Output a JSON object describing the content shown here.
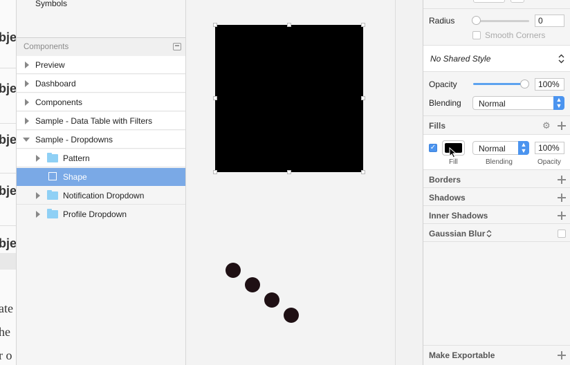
{
  "bg_doc": {
    "fragments_bold": [
      "bje",
      "bje",
      "bje",
      "bje",
      "bje"
    ],
    "fragments_serif": [
      "ate",
      "he",
      "r o"
    ]
  },
  "layers": {
    "symbols_label": "Symbols",
    "components_header": "Components",
    "rows": [
      {
        "label": "Preview"
      },
      {
        "label": "Dashboard"
      },
      {
        "label": "Components"
      },
      {
        "label": "Sample - Data Table with Filters"
      },
      {
        "label": "Sample - Dropdowns"
      },
      {
        "label": "Pattern"
      },
      {
        "label": "Shape"
      },
      {
        "label": "Notification Dropdown"
      },
      {
        "label": "Profile Dropdown"
      }
    ]
  },
  "inspector": {
    "radius_label": "Radius",
    "radius_value": "0",
    "smooth_corners_label": "Smooth Corners",
    "shared_style": "No Shared Style",
    "opacity_label": "Opacity",
    "opacity_value": "100%",
    "blending_label": "Blending",
    "blending_value": "Normal",
    "fills_title": "Fills",
    "fill_blending_value": "Normal",
    "fill_opacity_value": "100%",
    "fill_caption": "Fill",
    "fill_blending_caption": "Blending",
    "fill_opacity_caption": "Opacity",
    "fill_color": "#000000",
    "borders_title": "Borders",
    "shadows_title": "Shadows",
    "inner_shadows_title": "Inner Shadows",
    "gaussian_blur_title": "Gaussian Blur",
    "make_exportable_title": "Make Exportable"
  },
  "colors": {
    "selection": "#7aa9e6",
    "accent": "#4b94ef",
    "folder": "#8fd0f5"
  }
}
